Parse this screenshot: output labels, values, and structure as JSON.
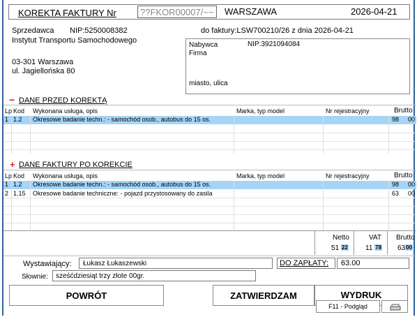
{
  "header": {
    "title": "KOREKTA FAKTURY Nr",
    "number": "??FKOR00007/~~",
    "city": "WARSZAWA",
    "date": "2026-04-21"
  },
  "seller": {
    "label": "Sprzedawca",
    "nip": "NIP:5250008382",
    "name": "Instytut Transportu Samochodowego",
    "address1": "03-301 Warszawa",
    "address2": "ul. Jagiellońska 80"
  },
  "invoice_ref": "do faktury:LSW700210/26 z dnia 2026-04-21",
  "buyer": {
    "label": "Nabywca",
    "nip": "NIP:3921094084",
    "name": "Firma",
    "address": "miasto, ulica"
  },
  "before": {
    "sign": "−",
    "title": "DANE PRZED KOREKTĄ",
    "columns": {
      "lp": "Lp",
      "kod": "Kod",
      "opis": "Wykonana usługa, opis",
      "marka": "Marka, typ model",
      "nr": "Nr rejestracyjny",
      "brutto": "Brutto"
    },
    "rows": [
      {
        "lp": "1",
        "kod": "1.2",
        "opis": "Okresowe badanie techn.: - samochód osob., autobus do 15 os.",
        "brutto": "98",
        "gr": "00"
      }
    ]
  },
  "after": {
    "sign": "+",
    "title": "DANE FAKTURY PO KOREKCIE",
    "columns": {
      "lp": "Lp",
      "kod": "Kod",
      "opis": "Wykonana usługa, opis",
      "marka": "Marka, typ model",
      "nr": "Nr rejestracyjny",
      "brutto": "Brutto"
    },
    "rows": [
      {
        "lp": "1",
        "kod": "1.2",
        "opis": "Okresowe badanie techn.: - samochód osob., autobus do 15 os.",
        "brutto": "98",
        "gr": "00"
      },
      {
        "lp": "2",
        "kod": "1.15",
        "opis": "Okresowe badanie techniczne: - pojazd przystosowany do zasila",
        "brutto": "63",
        "gr": "00"
      }
    ]
  },
  "totals": {
    "netto_label": "Netto",
    "vat_label": "VAT",
    "brutto_label": "Brutto",
    "netto": "51",
    "netto_gr": "22",
    "vat": "11",
    "vat_gr": "78",
    "brutto": "63",
    "brutto_gr": "00"
  },
  "issuer": {
    "label": "Wystawiający:",
    "value": "Łukasz Łukaszewski"
  },
  "payment": {
    "label": "DO ZAPŁATY:",
    "value": "63.00"
  },
  "words": {
    "label": "Słownie:",
    "value": "sześćdziesiąt trzy złote  00gr."
  },
  "buttons": {
    "back": "POWRÓT",
    "approve": "ZATWIERDZAM",
    "print": "WYDRUK",
    "preview": "F11 - Podgląd"
  },
  "colors": {
    "accent": "#a6d4f7",
    "minus": "#e0202a",
    "plus": "#e0202a",
    "frame": "#2e5f9e"
  }
}
